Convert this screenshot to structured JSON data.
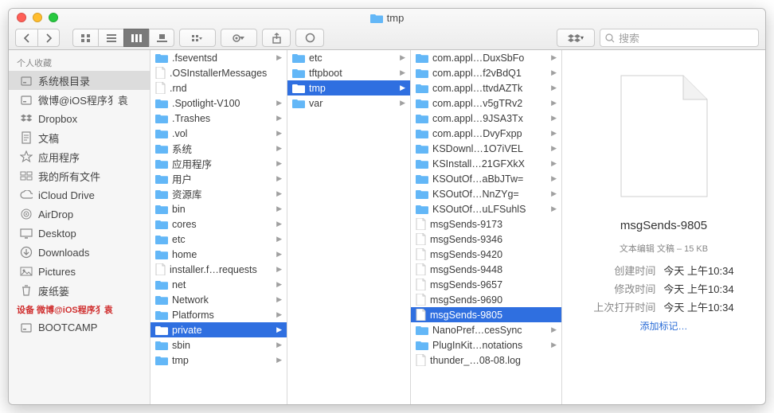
{
  "window": {
    "title": "tmp"
  },
  "toolbar": {
    "search_placeholder": "搜索"
  },
  "sidebar": {
    "sections": [
      {
        "header": "个人收藏",
        "header_style": "normal",
        "items": [
          {
            "icon": "hdd",
            "label": "系统根目录",
            "sel": true
          },
          {
            "icon": "hdd",
            "label": "微博@iOS程序犭袁"
          },
          {
            "icon": "db",
            "label": "Dropbox"
          },
          {
            "icon": "doc",
            "label": "文稿"
          },
          {
            "icon": "apps",
            "label": "应用程序"
          },
          {
            "icon": "all",
            "label": "我的所有文件"
          },
          {
            "icon": "cloud",
            "label": "iCloud Drive"
          },
          {
            "icon": "airdrop",
            "label": "AirDrop"
          },
          {
            "icon": "desktop",
            "label": "Desktop"
          },
          {
            "icon": "down",
            "label": "Downloads"
          },
          {
            "icon": "pic",
            "label": "Pictures"
          },
          {
            "icon": "trash",
            "label": "废纸篓"
          }
        ]
      },
      {
        "header": "设备 微博@iOS程序犭袁",
        "header_style": "red",
        "items": [
          {
            "icon": "hdd",
            "label": "BOOTCAMP"
          }
        ]
      }
    ]
  },
  "columns": [
    [
      {
        "t": "folder",
        "l": ".fseventsd",
        "a": true
      },
      {
        "t": "file",
        "l": ".OSInstallerMessages"
      },
      {
        "t": "file",
        "l": ".rnd"
      },
      {
        "t": "folder",
        "l": ".Spotlight-V100",
        "a": true
      },
      {
        "t": "folder",
        "l": ".Trashes",
        "a": true
      },
      {
        "t": "folder",
        "l": ".vol",
        "a": true
      },
      {
        "t": "folder",
        "l": "系统",
        "a": true
      },
      {
        "t": "folder",
        "l": "应用程序",
        "a": true
      },
      {
        "t": "folder",
        "l": "用户",
        "a": true
      },
      {
        "t": "folder",
        "l": "资源库",
        "a": true
      },
      {
        "t": "folder",
        "l": "bin",
        "a": true
      },
      {
        "t": "folder",
        "l": "cores",
        "a": true
      },
      {
        "t": "folder",
        "l": "etc",
        "a": true
      },
      {
        "t": "folder",
        "l": "home",
        "a": true
      },
      {
        "t": "file",
        "l": "installer.f…requests",
        "a": true
      },
      {
        "t": "folder",
        "l": "net",
        "a": true
      },
      {
        "t": "folder",
        "l": "Network",
        "a": true
      },
      {
        "t": "folder",
        "l": "Platforms",
        "a": true
      },
      {
        "t": "folder",
        "l": "private",
        "a": true,
        "sel": true
      },
      {
        "t": "folder",
        "l": "sbin",
        "a": true
      },
      {
        "t": "folder",
        "l": "tmp",
        "a": true
      }
    ],
    [
      {
        "t": "folder",
        "l": "etc",
        "a": true
      },
      {
        "t": "folder",
        "l": "tftpboot",
        "a": true
      },
      {
        "t": "folder",
        "l": "tmp",
        "a": true,
        "sel": true
      },
      {
        "t": "folder",
        "l": "var",
        "a": true
      }
    ],
    [
      {
        "t": "folder",
        "l": "com.appl…DuxSbFo",
        "a": true
      },
      {
        "t": "folder",
        "l": "com.appl…f2vBdQ1",
        "a": true
      },
      {
        "t": "folder",
        "l": "com.appl…ttvdAZTk",
        "a": true
      },
      {
        "t": "folder",
        "l": "com.appl…v5gTRv2",
        "a": true
      },
      {
        "t": "folder",
        "l": "com.appl…9JSA3Tx",
        "a": true
      },
      {
        "t": "folder",
        "l": "com.appl…DvyFxpp",
        "a": true
      },
      {
        "t": "folder",
        "l": "KSDownl…1O7iVEL",
        "a": true
      },
      {
        "t": "folder",
        "l": "KSInstall…21GFXkX",
        "a": true
      },
      {
        "t": "folder",
        "l": "KSOutOf…aBbJTw=",
        "a": true
      },
      {
        "t": "folder",
        "l": "KSOutOf…NnZYg=",
        "a": true
      },
      {
        "t": "folder",
        "l": "KSOutOf…uLFSuhlS",
        "a": true
      },
      {
        "t": "file",
        "l": "msgSends-9173"
      },
      {
        "t": "file",
        "l": "msgSends-9346"
      },
      {
        "t": "file",
        "l": "msgSends-9420"
      },
      {
        "t": "file",
        "l": "msgSends-9448"
      },
      {
        "t": "file",
        "l": "msgSends-9657"
      },
      {
        "t": "file",
        "l": "msgSends-9690"
      },
      {
        "t": "file",
        "l": "msgSends-9805",
        "sel": true
      },
      {
        "t": "folder",
        "l": "NanoPref…cesSync",
        "a": true
      },
      {
        "t": "folder",
        "l": "PlugInKit…notations",
        "a": true
      },
      {
        "t": "file",
        "l": "thunder_…08-08.log"
      }
    ]
  ],
  "preview": {
    "name": "msgSends-9805",
    "meta": "文本编辑 文稿 – 15 KB",
    "rows": [
      {
        "k": "创建时间",
        "v": "今天 上午10:34"
      },
      {
        "k": "修改时间",
        "v": "今天 上午10:34"
      },
      {
        "k": "上次打开时间",
        "v": "今天 上午10:34"
      }
    ],
    "add_tag": "添加标记…"
  }
}
